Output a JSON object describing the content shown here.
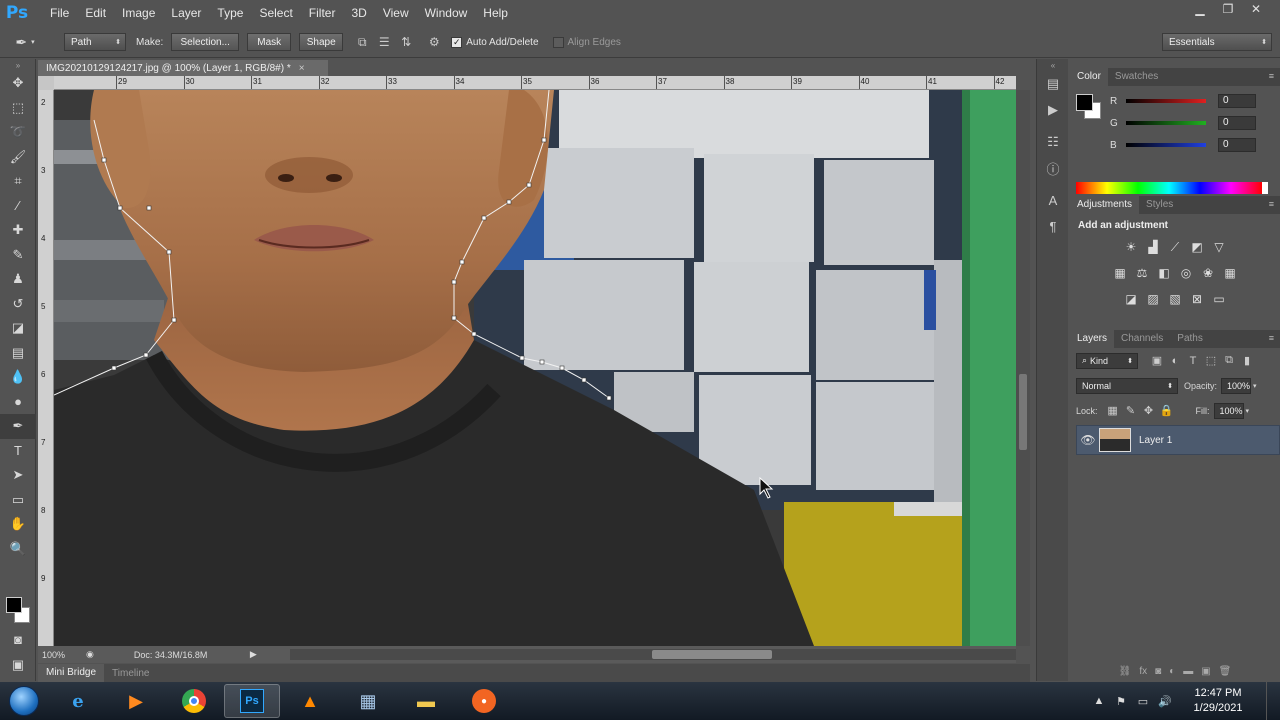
{
  "app": {
    "logo": "Ps"
  },
  "menu": [
    "File",
    "Edit",
    "Image",
    "Layer",
    "Type",
    "Select",
    "Filter",
    "3D",
    "View",
    "Window",
    "Help"
  ],
  "window_controls": {
    "minimize": "▁",
    "restore": "❐",
    "close": "✕"
  },
  "options_bar": {
    "tool_mode": "Path",
    "make_label": "Make:",
    "selection_button": "Selection...",
    "mask_button": "Mask",
    "shape_button": "Shape",
    "auto_add_delete": "Auto Add/Delete",
    "auto_add_checked": true,
    "align_edges": "Align Edges",
    "align_edges_checked": false,
    "workspace": "Essentials"
  },
  "document": {
    "tab_title": "IMG20210129124217.jpg @ 100% (Layer 1, RGB/8#) *",
    "zoom": "100%",
    "doc_size": "Doc: 34.3M/16.8M"
  },
  "rulers": {
    "top_ticks": [
      "29",
      "30",
      "31",
      "32",
      "33",
      "34",
      "35",
      "36",
      "37",
      "38",
      "39",
      "40",
      "41",
      "42"
    ],
    "left_ticks": [
      "2",
      "3",
      "4",
      "5",
      "6",
      "7",
      "8",
      "9"
    ]
  },
  "bottom_tabs": [
    "Mini Bridge",
    "Timeline"
  ],
  "color_panel": {
    "tabs": [
      "Color",
      "Swatches"
    ],
    "channels": [
      {
        "label": "R",
        "value": "0",
        "color": "#e02020"
      },
      {
        "label": "G",
        "value": "0",
        "color": "#20b020"
      },
      {
        "label": "B",
        "value": "0",
        "color": "#2040e0"
      }
    ]
  },
  "adjustments_panel": {
    "tabs": [
      "Adjustments",
      "Styles"
    ],
    "title": "Add an adjustment"
  },
  "layers_panel": {
    "tabs": [
      "Layers",
      "Channels",
      "Paths"
    ],
    "filter": "Kind",
    "blend_mode": "Normal",
    "opacity_label": "Opacity:",
    "opacity": "100%",
    "lock_label": "Lock:",
    "fill_label": "Fill:",
    "fill": "100%",
    "layers": [
      {
        "name": "Layer 1",
        "visible": true,
        "selected": true
      }
    ]
  },
  "taskbar": {
    "apps": [
      "windows-start",
      "internet-explorer",
      "media-player",
      "chrome",
      "photoshop",
      "vlc",
      "calculator",
      "file-explorer",
      "screen-recorder"
    ],
    "time": "12:47 PM",
    "date": "1/29/2021"
  }
}
